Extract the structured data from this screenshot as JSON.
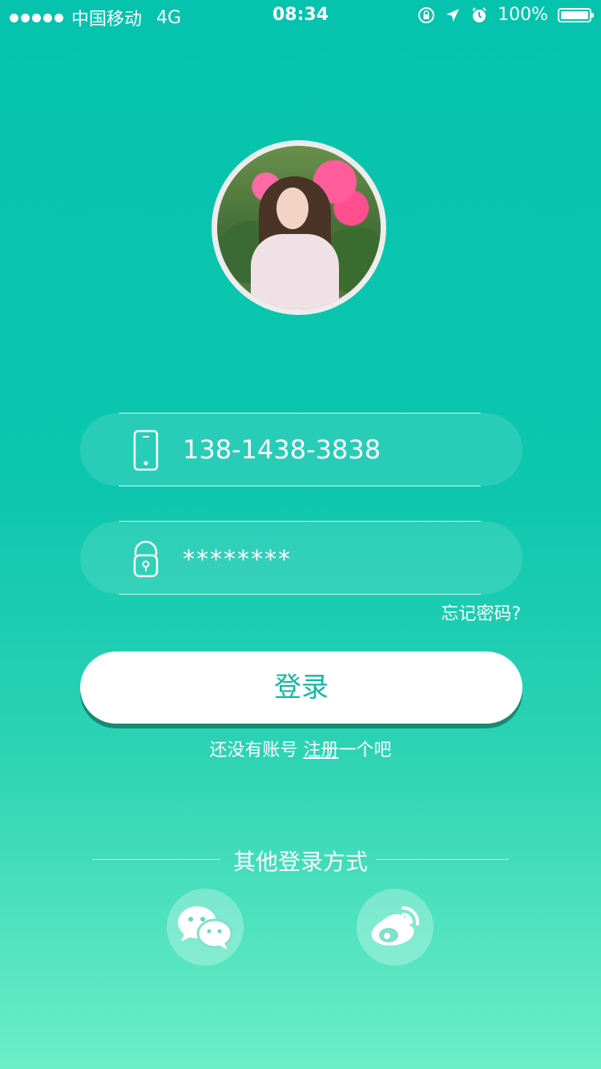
{
  "status_bar": {
    "carrier": "中国移动",
    "network": "4G",
    "time": "08:34",
    "battery": "100%"
  },
  "login": {
    "phone_value": "138-1438-3838",
    "password_value": "********",
    "forgot_password": "忘记密码?",
    "login_button": "登录",
    "register_prefix": "还没有账号 ",
    "register_link": "注册",
    "register_suffix": "一个吧"
  },
  "other_login": {
    "title": "其他登录方式",
    "providers": [
      "wechat",
      "weibo"
    ]
  },
  "icons": {
    "phone": "phone-icon",
    "lock": "lock-icon",
    "wechat": "wechat-icon",
    "weibo": "weibo-icon"
  },
  "colors": {
    "accent": "#06c3ad",
    "button_text": "#14b8a0"
  }
}
